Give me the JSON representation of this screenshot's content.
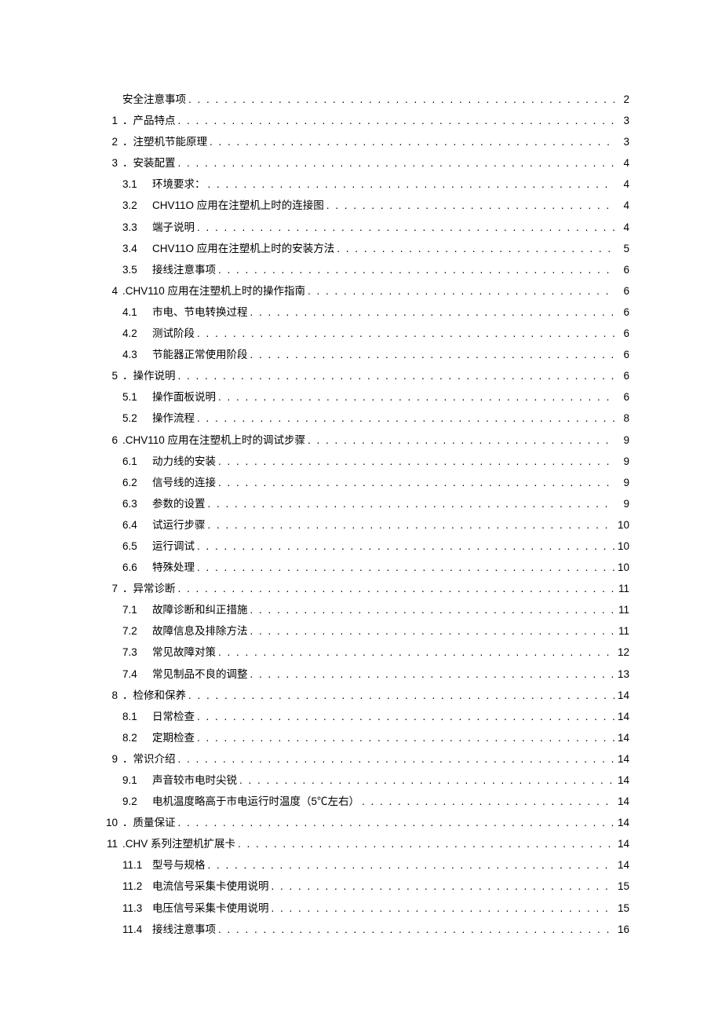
{
  "toc": [
    {
      "level": 0,
      "num": "",
      "sub": "",
      "title": "安全注意事项",
      "page": "2"
    },
    {
      "level": 0,
      "num": "1",
      "sub": "",
      "title": "．产品特点",
      "page": "3"
    },
    {
      "level": 0,
      "num": "2",
      "sub": "",
      "title": "．注塑机节能原理",
      "page": "3"
    },
    {
      "level": 0,
      "num": "3",
      "sub": "",
      "title": "．安装配置",
      "page": "4"
    },
    {
      "level": 1,
      "num": "",
      "sub": "3.1",
      "title": "环境要求：",
      "page": "4"
    },
    {
      "level": 1,
      "num": "",
      "sub": "3.2",
      "title": "CHV11O 应用在注塑机上时的连接图",
      "page": "4"
    },
    {
      "level": 1,
      "num": "",
      "sub": "3.3",
      "title": "端子说明",
      "page": "4"
    },
    {
      "level": 1,
      "num": "",
      "sub": "3.4",
      "title": "CHV11O 应用在注塑机上时的安装方法",
      "page": "5"
    },
    {
      "level": 1,
      "num": "",
      "sub": "3.5",
      "title": "接线注意事项",
      "page": "6"
    },
    {
      "level": 0,
      "num": "4",
      "sub": "",
      "title": ".CHV110 应用在注塑机上时的操作指南",
      "page": "6"
    },
    {
      "level": 1,
      "num": "",
      "sub": "4.1",
      "title": "市电、节电转换过程",
      "page": "6"
    },
    {
      "level": 1,
      "num": "",
      "sub": "4.2",
      "title": "测试阶段",
      "page": "6"
    },
    {
      "level": 1,
      "num": "",
      "sub": "4.3",
      "title": "节能器正常使用阶段",
      "page": "6"
    },
    {
      "level": 0,
      "num": "5",
      "sub": "",
      "title": "．操作说明",
      "page": "6"
    },
    {
      "level": 1,
      "num": "",
      "sub": "5.1",
      "title": "操作面板说明",
      "page": "6"
    },
    {
      "level": 1,
      "num": "",
      "sub": "5.2",
      "title": "操作流程",
      "page": "8"
    },
    {
      "level": 0,
      "num": "6",
      "sub": "",
      "title": ".CHV110 应用在注塑机上时的调试步骤",
      "page": "9"
    },
    {
      "level": 1,
      "num": "",
      "sub": "6.1",
      "title": "动力线的安装",
      "page": "9"
    },
    {
      "level": 1,
      "num": "",
      "sub": "6.2",
      "title": "信号线的连接",
      "page": "9"
    },
    {
      "level": 1,
      "num": "",
      "sub": "6.3",
      "title": "参数的设置",
      "page": "9"
    },
    {
      "level": 1,
      "num": "",
      "sub": "6.4",
      "title": "试运行步骤",
      "page": "10"
    },
    {
      "level": 1,
      "num": "",
      "sub": "6.5",
      "title": "运行调试",
      "page": "10"
    },
    {
      "level": 1,
      "num": "",
      "sub": "6.6",
      "title": "特殊处理",
      "page": "10"
    },
    {
      "level": 0,
      "num": "7",
      "sub": "",
      "title": "．异常诊断",
      "page": "11"
    },
    {
      "level": 1,
      "num": "",
      "sub": "7.1",
      "title": "故障诊断和纠正措施",
      "page": "11"
    },
    {
      "level": 1,
      "num": "",
      "sub": "7.2",
      "title": "故障信息及排除方法",
      "page": "11"
    },
    {
      "level": 1,
      "num": "",
      "sub": "7.3",
      "title": "常见故障对策",
      "page": "12"
    },
    {
      "level": 1,
      "num": "",
      "sub": "7.4",
      "title": "常见制品不良的调整",
      "page": "13"
    },
    {
      "level": 0,
      "num": "8",
      "sub": "",
      "title": "．检修和保养",
      "page": "14"
    },
    {
      "level": 1,
      "num": "",
      "sub": "8.1",
      "title": "日常检查",
      "page": "14"
    },
    {
      "level": 1,
      "num": "",
      "sub": "8.2",
      "title": "定期检查",
      "page": "14"
    },
    {
      "level": 0,
      "num": "9",
      "sub": "",
      "title": "．常识介绍",
      "page": "14"
    },
    {
      "level": 1,
      "num": "",
      "sub": "9.1",
      "title": "声音较市电时尖锐",
      "page": "14"
    },
    {
      "level": 1,
      "num": "",
      "sub": "9.2",
      "title": "电机温度略高于市电运行时温度（5℃左右）",
      "page": "14"
    },
    {
      "level": 0,
      "num": "10",
      "sub": "",
      "title": "．质量保证",
      "page": "14"
    },
    {
      "level": 0,
      "num": "11",
      "sub": "",
      "title": ".CHV 系列注塑机扩展卡",
      "page": "14"
    },
    {
      "level": 1,
      "num": "",
      "sub": "11.1",
      "title": "型号与规格",
      "page": "14"
    },
    {
      "level": 1,
      "num": "",
      "sub": "11.2",
      "title": "电流信号采集卡使用说明",
      "page": "15"
    },
    {
      "level": 1,
      "num": "",
      "sub": "11.3",
      "title": "电压信号采集卡使用说明",
      "page": "15"
    },
    {
      "level": 1,
      "num": "",
      "sub": "11.4",
      "title": "接线注意事项",
      "page": "16"
    }
  ]
}
